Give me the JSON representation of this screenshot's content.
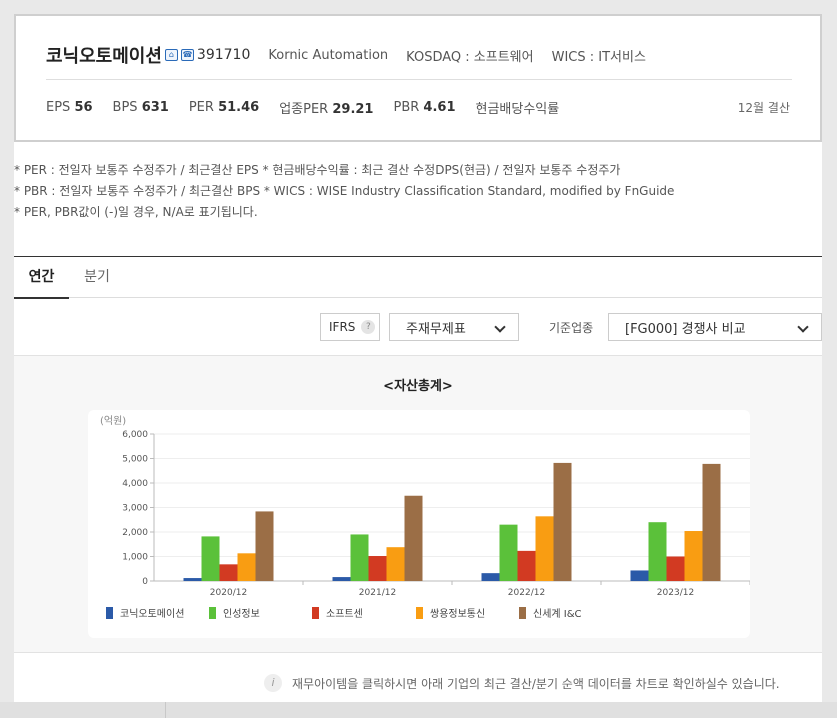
{
  "header": {
    "company_name": "코닉오토메이션",
    "code": "391710",
    "english_name": "Kornic Automation",
    "market": "KOSDAQ : 소프트웨어",
    "wics": "WICS : IT서비스",
    "icons": [
      "home-icon",
      "phone-icon"
    ],
    "settlement": "12월 결산"
  },
  "metrics": [
    {
      "label": "EPS",
      "value": "56"
    },
    {
      "label": "BPS",
      "value": "631"
    },
    {
      "label": "PER",
      "value": "51.46"
    },
    {
      "label": "업종PER",
      "value": "29.21"
    },
    {
      "label": "PBR",
      "value": "4.61"
    },
    {
      "label": "현금배당수익률",
      "value": ""
    }
  ],
  "notes": [
    "* PER : 전일자 보통주 수정주가 / 최근결산 EPS * 현금배당수익률 : 최근 결산 수정DPS(현금) / 전일자 보통주 수정주가",
    "* PBR : 전일자 보통주 수정주가 / 최근결산 BPS * WICS : WISE Industry Classification Standard, modified by FnGuide",
    "* PER, PBR값이 (-)일 경우, N/A로 표기됩니다."
  ],
  "tabs": [
    {
      "label": "연간",
      "active": true
    },
    {
      "label": "분기",
      "active": false
    }
  ],
  "controls": {
    "ifrs_label": "IFRS",
    "statement_select": "주재무제표",
    "industry_label": "기준업종",
    "industry_select": "[FG000] 경쟁사 비교"
  },
  "chart_data": {
    "type": "bar",
    "title": "<자산총계>",
    "ylabel": "(억원)",
    "ylim": [
      0,
      6000
    ],
    "yticks": [
      "0",
      "1,000",
      "2,000",
      "3,000",
      "4,000",
      "5,000",
      "6,000"
    ],
    "categories": [
      "2020/12",
      "2021/12",
      "2022/12",
      "2023/12"
    ],
    "legend_position": "bottom",
    "series": [
      {
        "name": "코닉오토메이션",
        "color": "#2b5aa8",
        "values": [
          120,
          160,
          320,
          430
        ]
      },
      {
        "name": "인성정보",
        "color": "#5bc13a",
        "values": [
          1820,
          1900,
          2300,
          2400
        ]
      },
      {
        "name": "소프트센",
        "color": "#d23a22",
        "values": [
          680,
          1020,
          1230,
          1000
        ]
      },
      {
        "name": "쌍용정보통신",
        "color": "#f99d12",
        "values": [
          1130,
          1380,
          2640,
          2040
        ]
      },
      {
        "name": "신세계 I&C",
        "color": "#9b6e46",
        "values": [
          2840,
          3480,
          4820,
          4780
        ]
      }
    ]
  },
  "info_text": "재무아이템을 클릭하시면 아래 기업의 최근 결산/분기 순액 데이터를 차트로 확인하실수 있습니다.",
  "info_icon": "i"
}
